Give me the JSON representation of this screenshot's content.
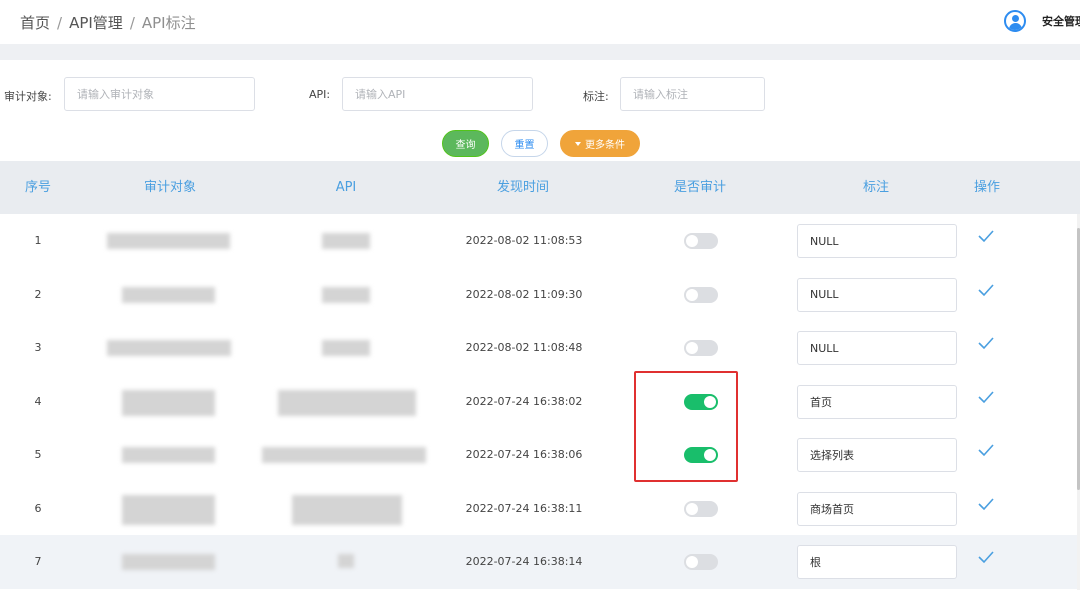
{
  "breadcrumb": {
    "home": "首页",
    "section": "API管理",
    "current": "API标注",
    "separator": "/"
  },
  "user": {
    "name": "安全管理"
  },
  "filters": {
    "audit_target": {
      "label": "审计对象:",
      "placeholder": "请输入审计对象",
      "value": ""
    },
    "api": {
      "label": "API:",
      "placeholder": "请输入API",
      "value": ""
    },
    "note": {
      "label": "标注:",
      "placeholder": "请输入标注",
      "value": ""
    }
  },
  "buttons": {
    "query": "查询",
    "reset": "重置",
    "more": "更多条件"
  },
  "table": {
    "headers": [
      "序号",
      "审计对象",
      "API",
      "发现时间",
      "是否审计",
      "标注",
      "操作"
    ],
    "rows": [
      {
        "index": "1",
        "time": "2022-08-02 11:08:53",
        "audited": false,
        "note": "NULL"
      },
      {
        "index": "2",
        "time": "2022-08-02 11:09:30",
        "audited": false,
        "note": "NULL"
      },
      {
        "index": "3",
        "time": "2022-08-02 11:08:48",
        "audited": false,
        "note": "NULL"
      },
      {
        "index": "4",
        "time": "2022-07-24 16:38:02",
        "audited": true,
        "note": "首页"
      },
      {
        "index": "5",
        "time": "2022-07-24 16:38:06",
        "audited": true,
        "note": "选择列表"
      },
      {
        "index": "6",
        "time": "2022-07-24 16:38:11",
        "audited": false,
        "note": "商场首页"
      },
      {
        "index": "7",
        "time": "2022-07-24 16:38:14",
        "audited": false,
        "note": "根"
      }
    ]
  },
  "colors": {
    "accent": "#2d8cf0",
    "switch_on": "#19be6b",
    "highlight": "#e03030",
    "query": "#5cb85c",
    "more": "#f0a43a"
  }
}
